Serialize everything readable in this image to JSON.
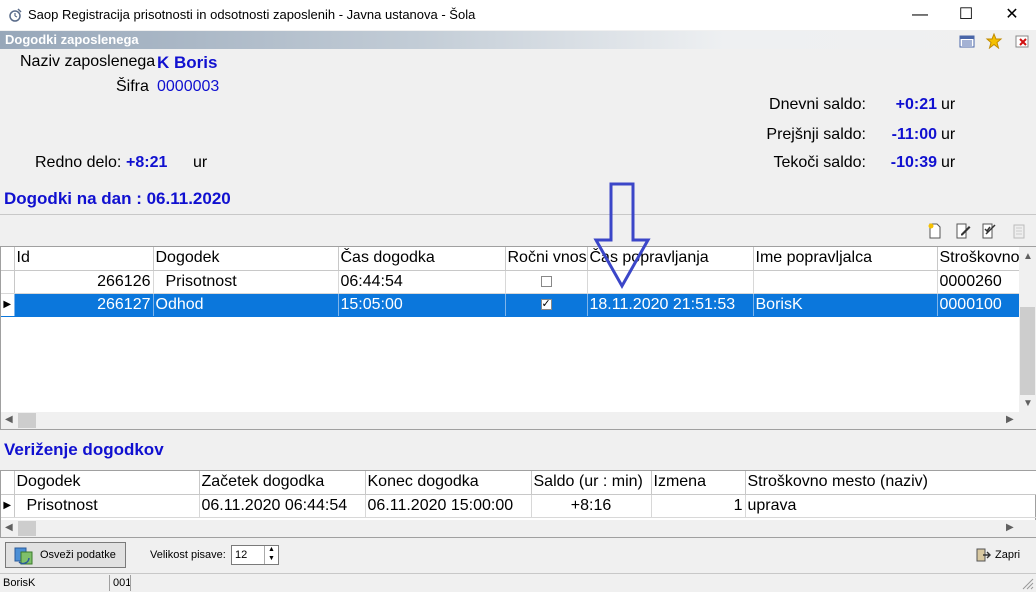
{
  "window": {
    "title": "Saop Registracija prisotnosti in odsotnosti zaposlenih - Javna ustanova - Šola",
    "min_glyph": "—",
    "max_glyph": "☐",
    "close_glyph": "✕"
  },
  "section_title": "Dogodki zaposlenega",
  "employee": {
    "name_label": "Naziv zaposlenega",
    "name_value": "K Boris",
    "code_label": "Šifra",
    "code_value": "0000003"
  },
  "balances": {
    "daily_label": "Dnevni saldo:",
    "daily_value": "+0:21",
    "previous_label": "Prejšnji saldo:",
    "previous_value": "-11:00",
    "current_label": "Tekoči saldo:",
    "current_value": "-10:39",
    "unit": "ur",
    "regular_label": "Redno delo:",
    "regular_value": "+8:21"
  },
  "events_heading": "Dogodki na dan : 06.11.2020",
  "events_table": {
    "columns": [
      "Id",
      "Dogodek",
      "Čas dogodka",
      "Ročni vnos",
      "Čas popravljanja",
      "Ime popravljalca",
      "Stroškovno"
    ],
    "rows": [
      {
        "id": "266126",
        "event": "Prisotnost",
        "time": "06:44:54",
        "manual": false,
        "edit_time": "",
        "editor": "",
        "cost": "0000260",
        "selected": false
      },
      {
        "id": "266127",
        "event": "Odhod",
        "time": "15:05:00",
        "manual": true,
        "edit_time": "18.11.2020 21:51:53",
        "editor": "BorisK",
        "cost": "0000100",
        "selected": true
      }
    ]
  },
  "chain_heading": "Veriženje dogodkov",
  "chain_table": {
    "columns": [
      "Dogodek",
      "Začetek dogodka",
      "Konec dogodka",
      "Saldo (ur : min)",
      "Izmena",
      "Stroškovno mesto (naziv)"
    ],
    "rows": [
      {
        "event": "Prisotnost",
        "start": "06.11.2020 06:44:54",
        "end": "06.11.2020 15:00:00",
        "balance": "+8:16",
        "shift": "1",
        "cost_name": "uprava"
      }
    ]
  },
  "toolbar": {
    "refresh_label": "Osveži podatke",
    "font_size_label": "Velikost pisave:",
    "font_size_value": "12",
    "close_label": "Zapri"
  },
  "status": {
    "user": "BorisK",
    "code": "001"
  },
  "colors": {
    "accent_blue": "#1010d0",
    "selection": "#0b77dc",
    "annotation_arrow": "#3b46c8"
  }
}
